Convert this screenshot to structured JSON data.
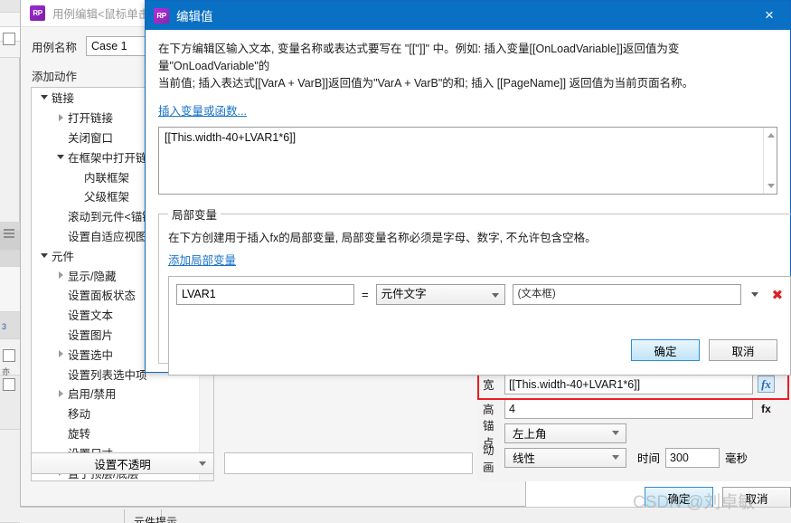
{
  "background_window": {
    "title": "用例编辑<鼠标单击 时>",
    "app_badge": "RP",
    "fields": {
      "case_name_label": "用例名称",
      "case_name_value": "Case 1",
      "add_action_label": "添加动作"
    },
    "action_tree": [
      {
        "label": "链接",
        "indent": 0,
        "twisty": "down"
      },
      {
        "label": "打开链接",
        "indent": 1,
        "twisty": "right"
      },
      {
        "label": "关闭窗口",
        "indent": 1,
        "twisty": "none"
      },
      {
        "label": "在框架中打开链接",
        "indent": 1,
        "twisty": "down"
      },
      {
        "label": "内联框架",
        "indent": 2,
        "twisty": "none"
      },
      {
        "label": "父级框架",
        "indent": 2,
        "twisty": "none"
      },
      {
        "label": "滚动到元件<锚链接>",
        "indent": 1,
        "twisty": "none"
      },
      {
        "label": "设置自适应视图",
        "indent": 1,
        "twisty": "none"
      },
      {
        "label": "元件",
        "indent": 0,
        "twisty": "down"
      },
      {
        "label": "显示/隐藏",
        "indent": 1,
        "twisty": "right"
      },
      {
        "label": "设置面板状态",
        "indent": 1,
        "twisty": "none"
      },
      {
        "label": "设置文本",
        "indent": 1,
        "twisty": "none"
      },
      {
        "label": "设置图片",
        "indent": 1,
        "twisty": "none"
      },
      {
        "label": "设置选中",
        "indent": 1,
        "twisty": "right"
      },
      {
        "label": "设置列表选中项",
        "indent": 1,
        "twisty": "none"
      },
      {
        "label": "启用/禁用",
        "indent": 1,
        "twisty": "right"
      },
      {
        "label": "移动",
        "indent": 1,
        "twisty": "none"
      },
      {
        "label": "旋转",
        "indent": 1,
        "twisty": "none"
      },
      {
        "label": "设置尺寸",
        "indent": 1,
        "twisty": "none"
      },
      {
        "label": "置于顶层/底层",
        "indent": 1,
        "twisty": "right"
      },
      {
        "label": "设置不透明",
        "indent": 1,
        "twisty": "none"
      }
    ],
    "behind_combo_value": "设置不透明",
    "properties": {
      "width_label": "宽",
      "width_value": "[[This.width-40+LVAR1*6]]",
      "width_fx": "fx",
      "height_label": "高",
      "height_value": "4",
      "height_fx": "fx",
      "anchor_label": "锚点",
      "anchor_value": "左上角",
      "animation_label": "动画",
      "animation_value": "线性",
      "duration_label": "时间",
      "duration_value": "300",
      "duration_unit": "毫秒"
    },
    "footer": {
      "ok": "确定",
      "cancel": "取消",
      "status_text": "元件提示"
    }
  },
  "dialog": {
    "app_badge": "RP",
    "title": "编辑值",
    "close_icon": "×",
    "description_line1": "在下方编辑区输入文本, 变量名称或表达式要写在 \"[[\"]]\" 中。例如: 插入变量[[OnLoadVariable]]返回值为变量\"OnLoadVariable\"的",
    "description_line2": "当前值; 插入表达式[[VarA + VarB]]返回值为\"VarA + VarB\"的和; 插入 [[PageName]] 返回值为当前页面名称。",
    "insert_link": "插入变量或函数...",
    "editor_value": "[[This.width-40+LVAR1*6]]",
    "local_variables": {
      "legend": "局部变量",
      "description": "在下方创建用于插入fx的局部变量, 局部变量名称必须是字母、数字, 不允许包含空格。",
      "add_link": "添加局部变量",
      "rows": [
        {
          "name": "LVAR1",
          "equals": "=",
          "type": "元件文字",
          "target": "(文本框)",
          "delete_icon": "✖"
        }
      ]
    },
    "buttons": {
      "ok": "确定",
      "cancel": "取消"
    }
  },
  "watermark": {
    "text": "CSDN @刘卓敏"
  },
  "colors": {
    "dialog_title_bar": "#0a70c4",
    "accent_link": "#1a73c8",
    "highlight_box": "#ee1c25",
    "delete_red": "#e02020",
    "fx_blue": "#1a6fb5"
  }
}
